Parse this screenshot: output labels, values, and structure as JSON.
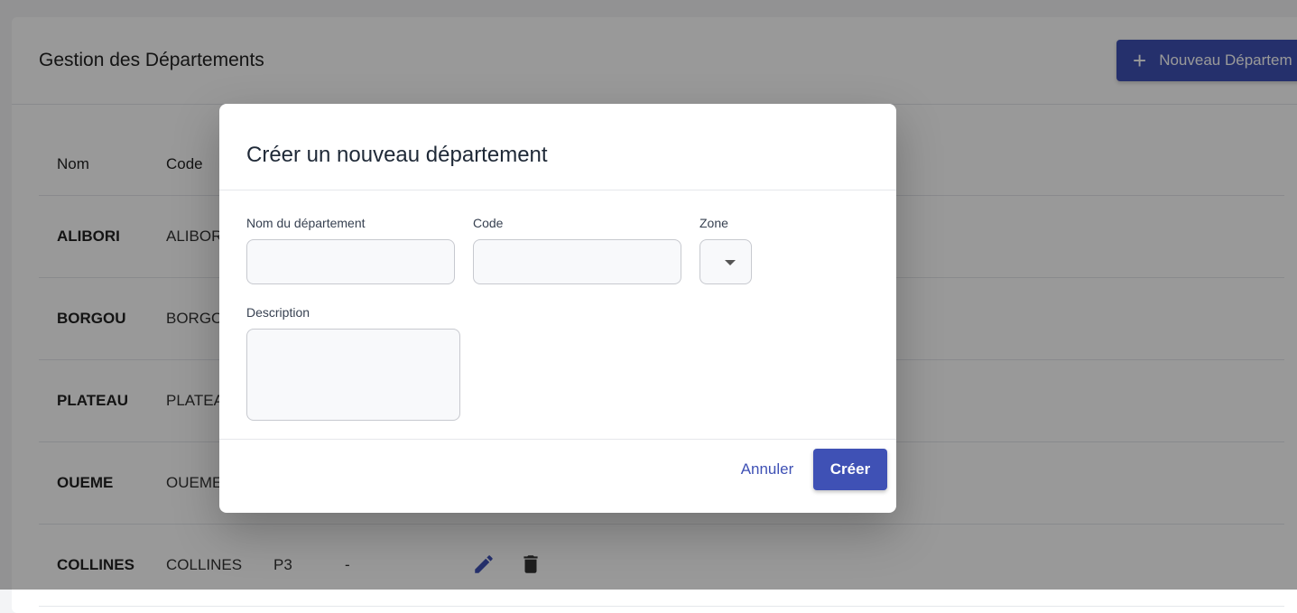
{
  "page": {
    "title": "Gestion des Départements",
    "new_button_icon": "plus-icon",
    "new_button_label": "Nouveau Départem"
  },
  "table": {
    "headers": {
      "name": "Nom",
      "code": "Code"
    },
    "rows": [
      {
        "name": "ALIBORI",
        "code": "ALIBOR",
        "zone": "",
        "description": ""
      },
      {
        "name": "BORGOU",
        "code": "BORGO",
        "zone": "",
        "description": ""
      },
      {
        "name": "PLATEAU",
        "code": "PLATEA",
        "zone": "",
        "description": ""
      },
      {
        "name": "OUEME",
        "code": "OUEME",
        "zone": "",
        "description": ""
      },
      {
        "name": "COLLINES",
        "code": "COLLINES",
        "zone": "P3",
        "description": "-"
      }
    ],
    "action_icons": [
      "pencil-icon",
      "trash-icon"
    ]
  },
  "dialog": {
    "title": "Créer un nouveau département",
    "name_label": "Nom du département",
    "name_value": "",
    "code_label": "Code",
    "code_value": "",
    "zone_label": "Zone",
    "zone_value": "",
    "description_label": "Description",
    "description_value": "",
    "cancel_label": "Annuler",
    "create_label": "Créer"
  },
  "colors": {
    "accent": "#3f51b5",
    "overlay": "rgba(0,0,0,0.40)"
  }
}
